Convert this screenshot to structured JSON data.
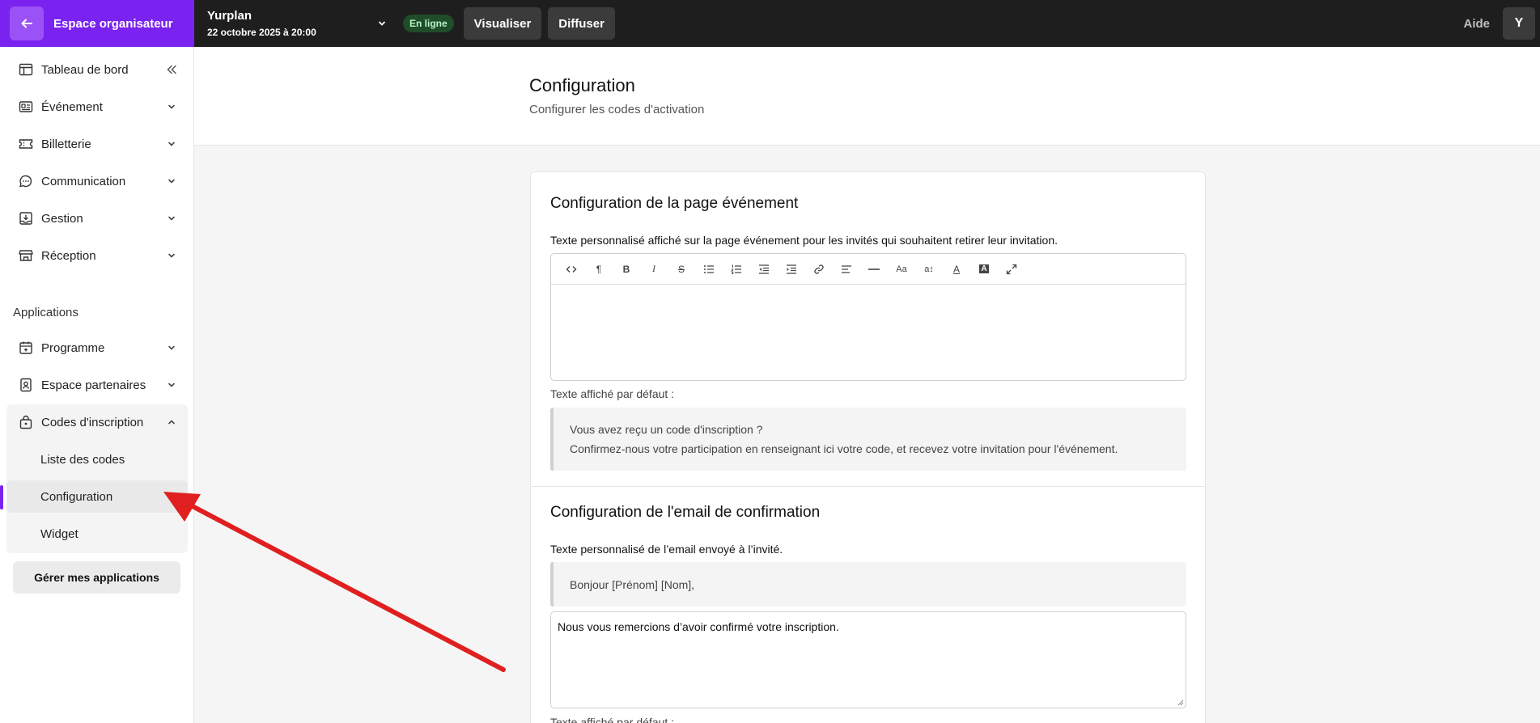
{
  "topbar": {
    "brand_label": "Espace organisateur",
    "event_name": "Yurplan",
    "event_date": "22 octobre 2025 à 20:00",
    "status_badge": "En ligne",
    "preview_label": "Visualiser",
    "share_label": "Diffuser",
    "help_label": "Aide",
    "avatar_initial": "Y"
  },
  "sidebar": {
    "items": [
      {
        "label": "Tableau de bord",
        "icon": "dashboard-icon"
      },
      {
        "label": "Événement",
        "icon": "event-card-icon"
      },
      {
        "label": "Billetterie",
        "icon": "ticket-icon"
      },
      {
        "label": "Communication",
        "icon": "chat-bubble-icon"
      },
      {
        "label": "Gestion",
        "icon": "download-box-icon"
      },
      {
        "label": "Réception",
        "icon": "store-icon"
      }
    ],
    "apps_section_title": "Applications",
    "apps": [
      {
        "label": "Programme",
        "icon": "calendar-plus-icon"
      },
      {
        "label": "Espace partenaires",
        "icon": "badge-icon"
      },
      {
        "label": "Codes d'inscription",
        "icon": "lock-bag-icon"
      }
    ],
    "sub_items": [
      "Liste des codes",
      "Configuration",
      "Widget"
    ],
    "active_sub_item": "Configuration",
    "manage_apps_label": "Gérer mes applications"
  },
  "page": {
    "title": "Configuration",
    "subtitle": "Configurer les codes d'activation"
  },
  "event_page_section": {
    "title": "Configuration de la page événement",
    "field_label": "Texte personnalisé affiché sur la page événement pour les invités qui souhaitent retirer leur invitation.",
    "default_label": "Texte affiché par défaut :",
    "default_line_1": "Vous avez reçu un code d'inscription ?",
    "default_line_2": "Confirmez-nous votre participation en renseignant ici votre code, et recevez votre invitation pour l'événement.",
    "toolbar_icons": [
      "code-icon",
      "paragraph-icon",
      "bold-icon",
      "italic-icon",
      "strikethrough-icon",
      "bullet-list-icon",
      "numbered-list-icon",
      "outdent-icon",
      "indent-icon",
      "link-icon",
      "align-left-icon",
      "horizontal-rule-icon",
      "font-size-icon",
      "line-height-icon",
      "text-color-icon",
      "background-color-icon",
      "fullscreen-icon"
    ]
  },
  "email_section": {
    "title": "Configuration de l'email de confirmation",
    "field_label": "Texte personnalisé de l’email envoyé à l’invité.",
    "greeting": "Bonjour [Prénom] [Nom],",
    "textarea_value": "Nous vous remercions d’avoir confirmé votre inscription.",
    "default_label": "Texte affiché par défaut :"
  },
  "colors": {
    "brand": "#7a22f0",
    "topbar": "#1e1e1e",
    "annotation_arrow": "#e02020"
  }
}
